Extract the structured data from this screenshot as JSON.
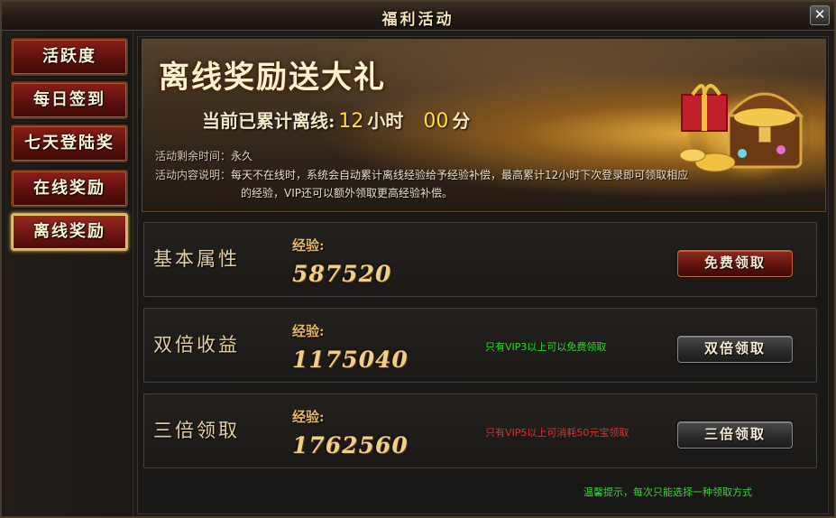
{
  "window": {
    "title": "福利活动",
    "close": "✕"
  },
  "sidebar": {
    "items": [
      {
        "label": "活跃度"
      },
      {
        "label": "每日签到"
      },
      {
        "label": "七天登陆奖"
      },
      {
        "label": "在线奖励"
      },
      {
        "label": "离线奖励",
        "active": true
      }
    ]
  },
  "banner": {
    "headline": "离线奖励送大礼",
    "offline_prefix": "当前已累计离线:",
    "hours": "12",
    "hours_unit": "小时",
    "minutes": "00",
    "minutes_unit": "分",
    "remaining_label": "活动剩余时间：",
    "remaining_value": "永久",
    "desc_label": "活动内容说明：",
    "desc_line1": "每天不在线时，系统会自动累计离线经验给予经验补偿，最高累计12小时下次登录即可领取相应",
    "desc_line2": "的经验，VIP还可以额外领取更高经验补偿。"
  },
  "rows": [
    {
      "name": "基本属性",
      "exp_label": "经验:",
      "exp_value": "587520",
      "note": "",
      "button": "免费领取"
    },
    {
      "name": "双倍收益",
      "exp_label": "经验:",
      "exp_value": "1175040",
      "note": "只有VIP3以上可以免费领取",
      "button": "双倍领取"
    },
    {
      "name": "三倍领取",
      "exp_label": "经验:",
      "exp_value": "1762560",
      "note": "只有VIP5以上可消耗50元宝领取",
      "button": "三倍领取"
    }
  ],
  "tip": "温馨提示，每次只能选择一种领取方式",
  "colors": {
    "note_green": "#2fd42f",
    "note_red": "#e0302a",
    "accent_gold": "#e8b85a",
    "counter_yellow": "#ffe02a"
  }
}
